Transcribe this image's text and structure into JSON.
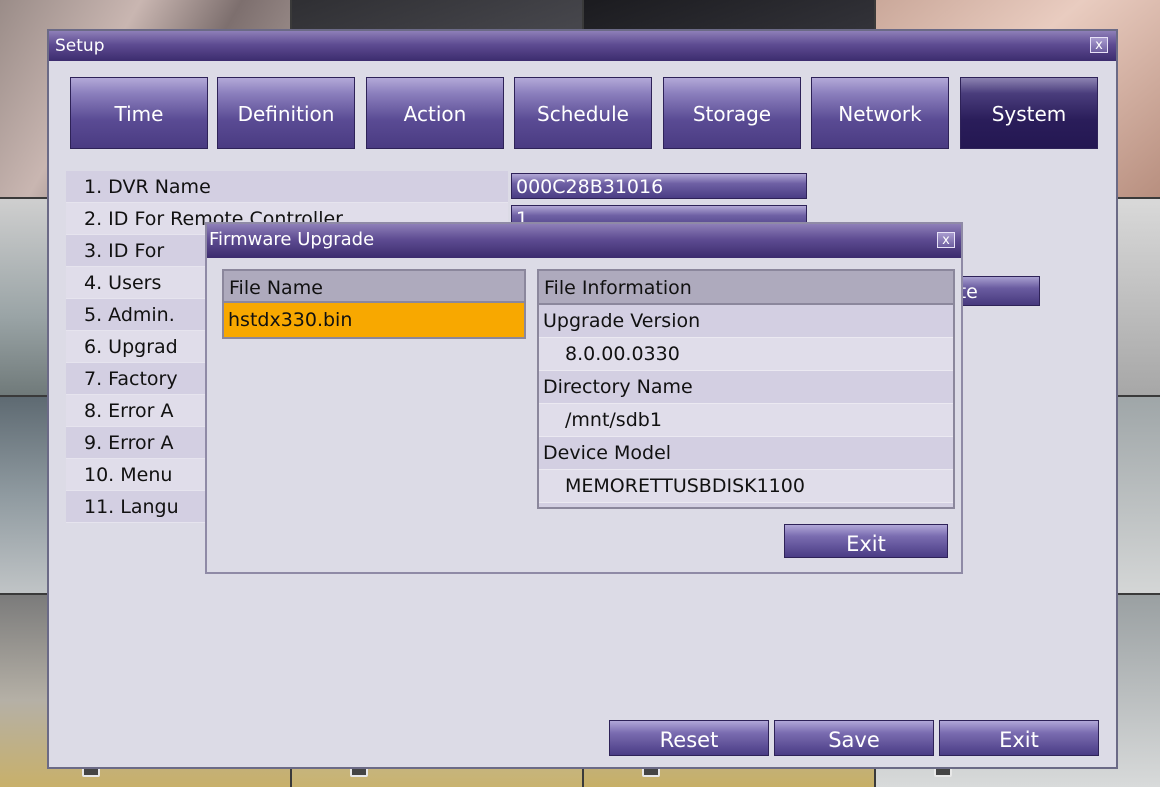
{
  "setup": {
    "title": "Setup",
    "close_label": "x",
    "tabs": [
      "Time",
      "Definition",
      "Action",
      "Schedule",
      "Storage",
      "Network",
      "System"
    ],
    "active_tab": "System",
    "items": [
      "1. DVR Name",
      "2. ID For Remote Controller",
      "3. ID For",
      "4. Users",
      "5. Admin.",
      "6. Upgrad",
      "7. Factory",
      "8. Error A",
      "9. Error A",
      "10. Menu",
      "11. Langu"
    ],
    "dvr_name_value": "000C28B31016",
    "remote_id_value": "1",
    "users_button_partial": "ete",
    "buttons": {
      "reset": "Reset",
      "save": "Save",
      "exit": "Exit"
    }
  },
  "firmware": {
    "title": "Firmware Upgrade",
    "close_label": "x",
    "file_name_header": "File Name",
    "files": [
      "hstdx330.bin"
    ],
    "info_header": "File Information",
    "info": {
      "upgrade_version_label": "Upgrade Version",
      "upgrade_version": "8.0.00.0330",
      "directory_name_label": "Directory Name",
      "directory_name": "/mnt/sdb1",
      "device_model_label": "Device Model",
      "device_model": "MEMORETTUSBDISK1100"
    },
    "exit_label": "Exit"
  },
  "colors": {
    "title_bar": "#5e4c92",
    "panel": "#dcdbe6",
    "selected_file": "#f8a800"
  }
}
